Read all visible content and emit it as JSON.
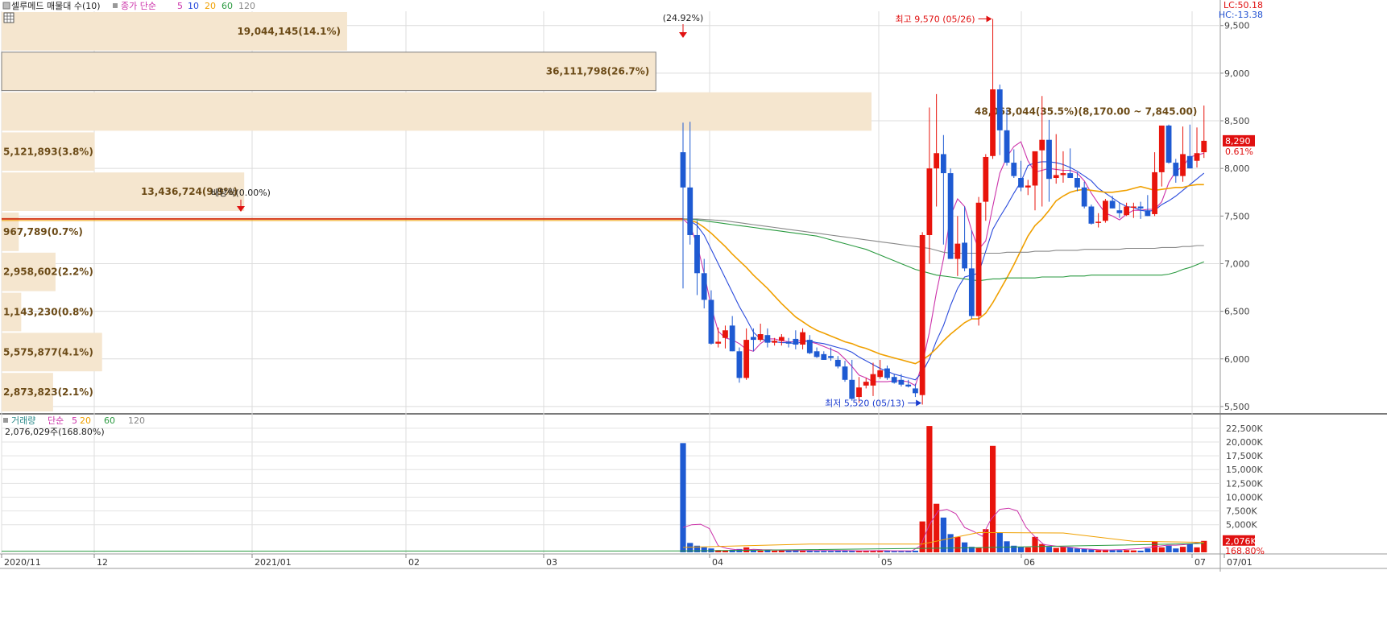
{
  "header": {
    "title": "셀루메드 매물대 수(10)",
    "legend": [
      {
        "label": "종가 단순",
        "color": "#cc33aa"
      },
      {
        "label": "5",
        "color": "#cc33aa"
      },
      {
        "label": "10",
        "color": "#2a4bdc"
      },
      {
        "label": "20",
        "color": "#f0a000"
      },
      {
        "label": "60",
        "color": "#2a9a40"
      },
      {
        "label": "120",
        "color": "#888888"
      }
    ],
    "right_info": [
      {
        "label": "LC:50.18",
        "color": "#e01010"
      },
      {
        "label": "HC:-13.38",
        "color": "#2050d0"
      }
    ]
  },
  "volume_header": {
    "legend": [
      {
        "label": "거래량",
        "color": "#2a8a8a"
      },
      {
        "label": "단순",
        "color": "#cc33aa"
      },
      {
        "label": "5",
        "color": "#cc33aa"
      },
      {
        "label": "20",
        "color": "#f0a000"
      },
      {
        "label": "60",
        "color": "#2a9a40"
      },
      {
        "label": "120",
        "color": "#888888"
      }
    ],
    "info": "2,076,029주(168.80%)"
  },
  "chart_data": [
    {
      "type": "candlestick",
      "y_ticks": [
        "9,500",
        "9,000",
        "8,500",
        "8,000",
        "7,500",
        "7,000",
        "6,500",
        "6,000",
        "5,500"
      ],
      "ylim": [
        5440,
        9650
      ],
      "x_ticks": [
        "2020/11",
        "12",
        "2021/01",
        "02",
        "03",
        "04",
        "05",
        "06",
        "07",
        "07/01"
      ],
      "flat_price_before_listing": 7470,
      "candles": [
        [
          8170,
          8480,
          6740,
          7800
        ],
        [
          7800,
          8490,
          7200,
          7300
        ],
        [
          7300,
          7450,
          6670,
          6900
        ],
        [
          6900,
          7050,
          6530,
          6620
        ],
        [
          6620,
          6720,
          6150,
          6160
        ],
        [
          6160,
          6330,
          6120,
          6180
        ],
        [
          6220,
          6350,
          6110,
          6300
        ],
        [
          6350,
          6450,
          6080,
          6080
        ],
        [
          6080,
          6120,
          5750,
          5800
        ],
        [
          5800,
          6320,
          5780,
          6200
        ],
        [
          6230,
          6320,
          6080,
          6200
        ],
        [
          6200,
          6370,
          6180,
          6260
        ],
        [
          6250,
          6320,
          6120,
          6170
        ],
        [
          6170,
          6220,
          6140,
          6190
        ],
        [
          6190,
          6260,
          6140,
          6230
        ],
        [
          6180,
          6220,
          6120,
          6160
        ],
        [
          6210,
          6300,
          6100,
          6150
        ],
        [
          6150,
          6320,
          6100,
          6280
        ],
        [
          6200,
          6250,
          6050,
          6060
        ],
        [
          6080,
          6120,
          6010,
          6020
        ],
        [
          6050,
          6080,
          5990,
          5990
        ],
        [
          6030,
          6120,
          5980,
          6010
        ],
        [
          5990,
          6030,
          5900,
          5920
        ],
        [
          5920,
          5980,
          5760,
          5780
        ],
        [
          5780,
          5990,
          5560,
          5580
        ],
        [
          5600,
          5810,
          5540,
          5700
        ],
        [
          5720,
          5800,
          5690,
          5760
        ],
        [
          5720,
          5960,
          5610,
          5840
        ],
        [
          5810,
          5990,
          5790,
          5880
        ],
        [
          5900,
          5930,
          5780,
          5800
        ],
        [
          5810,
          5840,
          5740,
          5750
        ],
        [
          5780,
          5840,
          5710,
          5730
        ],
        [
          5730,
          5780,
          5700,
          5710
        ],
        [
          5690,
          5740,
          5600,
          5640
        ],
        [
          5620,
          7330,
          5520,
          7300
        ],
        [
          7300,
          8640,
          7000,
          8000
        ],
        [
          8000,
          8780,
          7600,
          8160
        ],
        [
          8150,
          8350,
          7200,
          7950
        ],
        [
          7950,
          8000,
          7050,
          7050
        ],
        [
          7050,
          7500,
          6870,
          7210
        ],
        [
          7220,
          7600,
          6920,
          6950
        ],
        [
          6950,
          7350,
          6420,
          6450
        ],
        [
          6450,
          7700,
          6350,
          7640
        ],
        [
          7650,
          8150,
          7450,
          8120
        ],
        [
          8130,
          9570,
          8100,
          8830
        ],
        [
          8830,
          8880,
          8140,
          8400
        ],
        [
          8400,
          8620,
          8030,
          8060
        ],
        [
          8060,
          8200,
          7900,
          7920
        ],
        [
          7900,
          8080,
          7760,
          7800
        ],
        [
          7800,
          7880,
          7720,
          7820
        ],
        [
          7820,
          8150,
          7560,
          8180
        ],
        [
          8190,
          8760,
          7600,
          8300
        ],
        [
          8300,
          8510,
          7650,
          7890
        ],
        [
          7900,
          8360,
          7840,
          7930
        ],
        [
          7930,
          8180,
          7850,
          7950
        ],
        [
          7950,
          8210,
          7910,
          7900
        ],
        [
          7900,
          7960,
          7760,
          7800
        ],
        [
          7800,
          7860,
          7580,
          7600
        ],
        [
          7600,
          7620,
          7410,
          7420
        ],
        [
          7440,
          7530,
          7380,
          7440
        ],
        [
          7450,
          7680,
          7430,
          7660
        ],
        [
          7660,
          7710,
          7580,
          7580
        ],
        [
          7560,
          7640,
          7480,
          7530
        ],
        [
          7510,
          7640,
          7500,
          7600
        ],
        [
          7590,
          7640,
          7480,
          7600
        ],
        [
          7600,
          7650,
          7470,
          7580
        ],
        [
          7560,
          7720,
          7500,
          7500
        ],
        [
          7520,
          8170,
          7500,
          7960
        ],
        [
          7960,
          8440,
          7810,
          8450
        ],
        [
          8450,
          8460,
          8050,
          8060
        ],
        [
          8060,
          8100,
          7850,
          7920
        ],
        [
          7920,
          8440,
          7860,
          8150
        ],
        [
          8130,
          8460,
          8000,
          8000
        ],
        [
          8080,
          8430,
          8010,
          8160
        ],
        [
          8170,
          8660,
          8110,
          8290
        ]
      ],
      "moving_averages": [
        {
          "name": "5",
          "color": "#cc33aa",
          "values": [
            7470,
            7400,
            7200,
            6900,
            6550,
            6290,
            6220,
            6200,
            6160,
            6100,
            6080,
            6160,
            6210,
            6210,
            6190,
            6180,
            6180,
            6200,
            6180,
            6160,
            6130,
            6100,
            6070,
            6000,
            5920,
            5830,
            5800,
            5760,
            5760,
            5760,
            5770,
            5770,
            5760,
            5720,
            5950,
            6280,
            6700,
            7050,
            7500,
            7680,
            7600,
            7350,
            7150,
            7240,
            7600,
            7950,
            8120,
            8230,
            8280,
            8080,
            7960,
            7980,
            8000,
            7990,
            7980,
            7980,
            7950,
            7870,
            7740,
            7630,
            7530,
            7500,
            7460,
            7520,
            7560,
            7560,
            7570,
            7570,
            7650,
            7850,
            7970,
            8020,
            8120,
            8140,
            8160
          ]
        },
        {
          "name": "10",
          "color": "#2a4bdc",
          "values": [
            7470,
            7450,
            7400,
            7300,
            7150,
            7000,
            6850,
            6700,
            6550,
            6420,
            6280,
            6210,
            6190,
            6180,
            6170,
            6170,
            6160,
            6180,
            6190,
            6170,
            6160,
            6140,
            6120,
            6100,
            6070,
            6020,
            5980,
            5940,
            5900,
            5870,
            5840,
            5820,
            5800,
            5780,
            5860,
            6000,
            6190,
            6350,
            6560,
            6740,
            6860,
            6880,
            6900,
            7130,
            7360,
            7490,
            7610,
            7740,
            7860,
            8030,
            8060,
            8070,
            8070,
            8060,
            8040,
            8010,
            7970,
            7920,
            7870,
            7790,
            7740,
            7690,
            7640,
            7600,
            7590,
            7560,
            7550,
            7560,
            7620,
            7660,
            7710,
            7770,
            7830,
            7890,
            7950
          ]
        },
        {
          "name": "20",
          "color": "#f0a000",
          "values": [
            7470,
            7460,
            7430,
            7380,
            7320,
            7250,
            7180,
            7100,
            7030,
            6960,
            6880,
            6810,
            6740,
            6660,
            6580,
            6510,
            6440,
            6390,
            6340,
            6300,
            6270,
            6240,
            6210,
            6180,
            6160,
            6130,
            6110,
            6080,
            6050,
            6030,
            6010,
            5990,
            5970,
            5950,
            5990,
            6040,
            6110,
            6190,
            6260,
            6320,
            6380,
            6420,
            6420,
            6480,
            6590,
            6720,
            6850,
            6990,
            7140,
            7290,
            7400,
            7470,
            7560,
            7660,
            7710,
            7750,
            7770,
            7780,
            7770,
            7760,
            7750,
            7750,
            7760,
            7770,
            7790,
            7810,
            7790,
            7770,
            7780,
            7790,
            7800,
            7800,
            7820,
            7830,
            7830
          ]
        },
        {
          "name": "60",
          "color": "#2a9a40",
          "values": [
            7470,
            7470,
            7460,
            7450,
            7440,
            7430,
            7420,
            7410,
            7400,
            7390,
            7380,
            7370,
            7360,
            7350,
            7340,
            7330,
            7320,
            7310,
            7300,
            7290,
            7270,
            7250,
            7230,
            7210,
            7190,
            7170,
            7150,
            7120,
            7090,
            7060,
            7030,
            7000,
            6970,
            6940,
            6920,
            6900,
            6880,
            6870,
            6860,
            6850,
            6840,
            6830,
            6820,
            6830,
            6840,
            6840,
            6850,
            6850,
            6850,
            6850,
            6850,
            6860,
            6860,
            6860,
            6860,
            6870,
            6870,
            6870,
            6880,
            6880,
            6880,
            6880,
            6880,
            6880,
            6880,
            6880,
            6880,
            6880,
            6880,
            6890,
            6910,
            6940,
            6960,
            6990,
            7020
          ]
        },
        {
          "name": "120",
          "color": "#888888",
          "values": [
            7470,
            7470,
            7470,
            7465,
            7460,
            7455,
            7450,
            7440,
            7430,
            7420,
            7410,
            7400,
            7390,
            7380,
            7370,
            7360,
            7350,
            7340,
            7330,
            7320,
            7310,
            7300,
            7290,
            7280,
            7270,
            7260,
            7250,
            7240,
            7230,
            7220,
            7210,
            7200,
            7190,
            7180,
            7170,
            7160,
            7140,
            7120,
            7110,
            7110,
            7110,
            7110,
            7110,
            7110,
            7110,
            7110,
            7120,
            7120,
            7120,
            7120,
            7130,
            7130,
            7130,
            7140,
            7140,
            7140,
            7140,
            7150,
            7150,
            7150,
            7150,
            7150,
            7150,
            7160,
            7160,
            7160,
            7160,
            7160,
            7170,
            7170,
            7170,
            7180,
            7180,
            7190,
            7190
          ]
        }
      ],
      "volume_profile": [
        {
          "label": "2,873,823(2.1%)",
          "pct": 2.1
        },
        {
          "label": "5,575,877(4.1%)",
          "pct": 4.1
        },
        {
          "label": "1,143,230(0.8%)",
          "pct": 0.8
        },
        {
          "label": "2,958,602(2.2%)",
          "pct": 2.2
        },
        {
          "label": "967,789(0.7%)",
          "pct": 0.7
        },
        {
          "label": "13,436,724(9.9%)",
          "pct": 9.9
        },
        {
          "label": "5,121,893(3.8%)",
          "pct": 3.8
        },
        {
          "label": "48,063,044(35.5%)(8,170.00 ~ 7,845.00)",
          "pct": 35.5
        },
        {
          "label": "36,111,798(26.7%)",
          "pct": 26.7
        },
        {
          "label": "19,044,145(14.1%)",
          "pct": 14.1
        }
      ],
      "annotations": [
        {
          "text": "(24.92%)",
          "price": 9570,
          "color": "#222222"
        },
        {
          "text": "최고 9,570 (05/26)",
          "price": 9570,
          "color": "#e01010"
        },
        {
          "text": "최저 5,520 (05/13)",
          "price": 5520,
          "color": "#1a3bd0"
        },
        {
          "text": "배당락(0.00%)",
          "price": 7470,
          "color": "#222222"
        }
      ],
      "current_price": {
        "label": "8,290",
        "change": "0.61%",
        "color": "#e01010"
      }
    },
    {
      "type": "bar",
      "title": "거래량",
      "y_ticks": [
        "22,500K",
        "20,000K",
        "17,500K",
        "15,000K",
        "12,500K",
        "10,000K",
        "7,500K",
        "5,000K"
      ],
      "ylim": [
        0,
        23500
      ],
      "unit": "K",
      "volumes": [
        19800,
        1700,
        1200,
        900,
        700,
        400,
        300,
        450,
        600,
        900,
        350,
        300,
        400,
        300,
        300,
        350,
        450,
        350,
        300,
        250,
        250,
        250,
        300,
        300,
        350,
        300,
        300,
        350,
        300,
        250,
        200,
        200,
        250,
        300,
        5600,
        22900,
        8800,
        6300,
        3300,
        2800,
        1800,
        1000,
        800,
        4200,
        19300,
        3600,
        2000,
        1200,
        1000,
        900,
        2800,
        1500,
        1000,
        800,
        1000,
        900,
        700,
        600,
        500,
        400,
        500,
        400,
        400,
        400,
        350,
        300,
        700,
        2000,
        900,
        1200,
        700,
        1000,
        1500,
        900,
        2076
      ],
      "volume_ma5": [
        4500,
        5000,
        5100,
        4300,
        1200,
        700,
        500,
        400,
        550,
        480,
        450,
        360,
        330,
        340,
        340,
        340,
        330,
        330,
        320,
        300,
        280,
        280,
        300,
        300,
        280,
        280,
        250,
        1200,
        5000,
        7500,
        7800,
        7000,
        4500,
        3800,
        2900,
        6000,
        7800,
        8000,
        7500,
        4500,
        2800,
        1400,
        1200,
        1000,
        900,
        700,
        600,
        500,
        400,
        450,
        500,
        600,
        700,
        900,
        1100,
        1300,
        1300,
        1400,
        1600,
        1900
      ]
    }
  ],
  "current_volume": {
    "label": "2,076K",
    "change": "168.80%"
  }
}
